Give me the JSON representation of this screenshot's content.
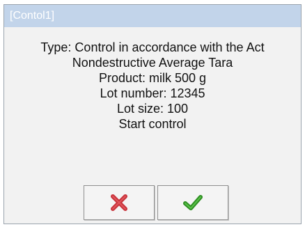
{
  "dialog": {
    "title": "[Contol1]",
    "lines": [
      "Type: Control in accordance with the Act",
      "Nondestructive Average Tara",
      "Product: milk 500 g",
      "Lot number: 12345",
      "Lot size: 100",
      "Start control"
    ]
  },
  "buttons": {
    "cancel_icon": "red-x-icon",
    "ok_icon": "green-checkmark-icon"
  },
  "colors": {
    "title_bar": "#c2d4ea",
    "cancel_icon": "#c8323a",
    "ok_icon": "#3aa32c"
  }
}
